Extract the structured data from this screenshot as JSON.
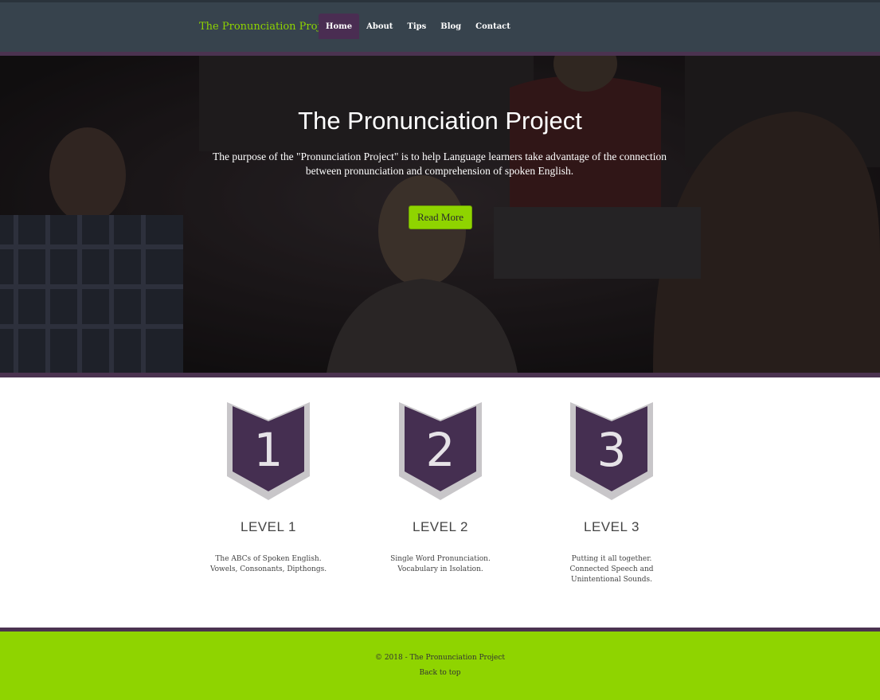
{
  "navbar": {
    "brand": "The Pronunciation Project",
    "items": [
      {
        "label": "Home",
        "active": true
      },
      {
        "label": "About"
      },
      {
        "label": "Tips"
      },
      {
        "label": "Blog"
      },
      {
        "label": "Contact"
      }
    ]
  },
  "hero": {
    "title": "The Pronunciation Project",
    "text": "The purpose of the \"Pronunciation Project\" is to help Language learners take advantage of the connection between pronunciation and comprehension of spoken English.",
    "button": "Read More"
  },
  "levels": [
    {
      "number": "1",
      "title": "LEVEL 1",
      "line1": "The ABCs of Spoken English.",
      "line2": "Vowels, Consonants, Dipthongs."
    },
    {
      "number": "2",
      "title": "LEVEL 2",
      "line1": "Single Word Pronunciation.",
      "line2": "Vocabulary in Isolation."
    },
    {
      "number": "3",
      "title": "LEVEL 3",
      "line1": "Putting it all together.",
      "line2": "Connected Speech and Unintentional Sounds."
    }
  ],
  "footer": {
    "copyright": "© 2018 - The Pronunciation Project",
    "back_to_top": "Back to top"
  },
  "colors": {
    "accent_green": "#8fd400",
    "purple": "#4a2d52",
    "nav_bg": "#37434d"
  }
}
